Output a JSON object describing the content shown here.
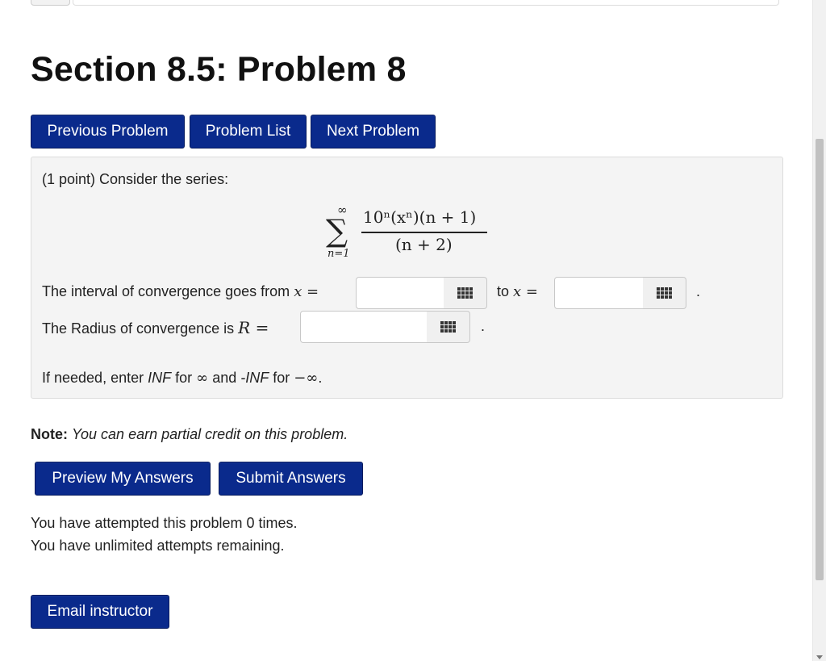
{
  "page": {
    "title": "Section 8.5: Problem 8"
  },
  "nav": {
    "previous": "Previous Problem",
    "list": "Problem List",
    "next": "Next Problem"
  },
  "problem": {
    "points": "(1 point) Consider the series:",
    "series": {
      "upper": "∞",
      "lower": "n=1",
      "numerator": "10ⁿ(xⁿ)(n + 1)",
      "denominator": "(n + 2)"
    },
    "interval_label": "The interval of convergence goes from",
    "x_eq": "x =",
    "to_label": "to",
    "x_eq2": "x =",
    "period1": ".",
    "radius_label": "The Radius of convergence is",
    "r_eq": "R =",
    "period2": ".",
    "from_value": "",
    "to_value": "",
    "radius_value": "",
    "hint_prefix": "If needed, enter",
    "hint_inf": "INF",
    "hint_for1": "for",
    "hint_sym1": "∞",
    "hint_and": "and",
    "hint_neginf": "-INF",
    "hint_for2": "for",
    "hint_sym2": "−∞",
    "hint_end": "."
  },
  "note": {
    "label": "Note:",
    "text": "You can earn partial credit on this problem."
  },
  "actions": {
    "preview": "Preview My Answers",
    "submit": "Submit Answers"
  },
  "status": {
    "attempts": "You have attempted this problem 0 times.",
    "remaining": "You have unlimited attempts remaining."
  },
  "email": {
    "label": "Email instructor"
  },
  "colors": {
    "button": "#0a2a8c",
    "panel": "#f4f4f4"
  },
  "icons": {
    "keyboard": "grid-keyboard-icon"
  }
}
